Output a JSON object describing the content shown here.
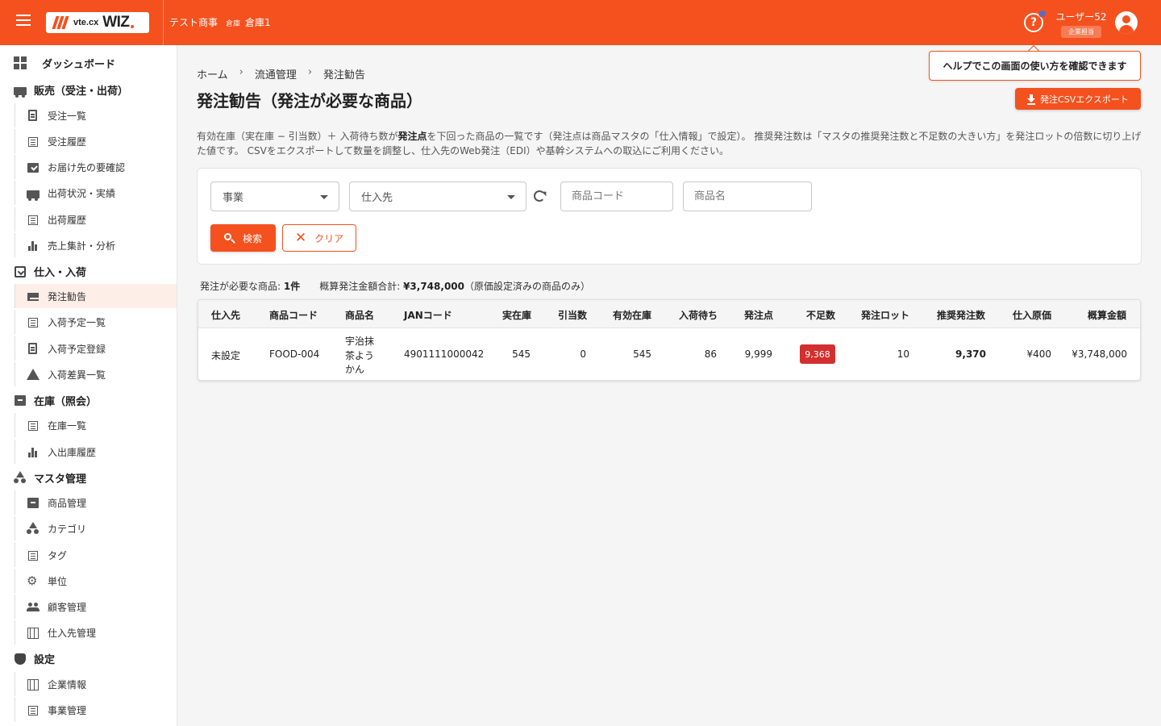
{
  "header": {
    "logo_small": "vte.cx",
    "logo_big": "WIZ",
    "company": "テスト商事",
    "warehouse_label": "倉庫",
    "warehouse": "倉庫1",
    "help_glyph": "?",
    "user_name": "ユーザー52",
    "user_role": "企業担当"
  },
  "tooltip": {
    "text": "ヘルプでこの画面の使い方を確認できます"
  },
  "sidebar": {
    "dashboard": "ダッシュボード",
    "sales": {
      "label": "販売（受注・出荷）",
      "items": [
        "受注一覧",
        "受注履歴",
        "お届け先の要確認",
        "出荷状況・実績",
        "出荷履歴",
        "売上集計・分析"
      ]
    },
    "purchase": {
      "label": "仕入・入荷",
      "items": [
        "発注勧告",
        "入荷予定一覧",
        "入荷予定登録",
        "入荷差異一覧"
      ]
    },
    "inventory": {
      "label": "在庫（照会）",
      "items": [
        "在庫一覧",
        "入出庫履歴"
      ]
    },
    "master": {
      "label": "マスタ管理",
      "items": [
        "商品管理",
        "カテゴリ",
        "タグ",
        "単位",
        "顧客管理",
        "仕入先管理"
      ]
    },
    "settings": {
      "label": "設定",
      "items": [
        "企業情報",
        "事業管理"
      ]
    },
    "gear_glyph": "⚙"
  },
  "breadcrumb": {
    "items": [
      "ホーム",
      "流通管理",
      "発注勧告"
    ],
    "sep": "›"
  },
  "page": {
    "title": "発注勧告（発注が必要な商品）",
    "export_label": "発注CSVエクスポート",
    "desc_a": "有効在庫（実在庫 − 引当数）＋ 入荷待ち数が",
    "desc_bold": "発注点",
    "desc_b": "を下回った商品の一覧です（発注点は商品マスタの「仕入情報」で設定）。 推奨発注数は「マスタの推奨発注数と不足数の大きい方」を発注ロットの倍数に切り上げた値です。 CSVをエクスポートして数量を調整し、仕入先のWeb発注（EDI）や基幹システムへの取込にご利用ください。"
  },
  "filters": {
    "business_label": "事業",
    "supplier_label": "仕入先",
    "product_code_placeholder": "商品コード",
    "product_name_placeholder": "商品名",
    "search_label": "検索",
    "clear_label": "クリア",
    "clear_glyph": "✕"
  },
  "summary": {
    "count_label": "発注が必要な商品: ",
    "count_value": "1件",
    "total_label": "概算発注金額合計: ",
    "total_value": "¥3,748,000",
    "total_note": "（原価設定済みの商品のみ）"
  },
  "table": {
    "headers": [
      "仕入先",
      "商品コード",
      "商品名",
      "JANコード",
      "実在庫",
      "引当数",
      "有効在庫",
      "入荷待ち",
      "発注点",
      "不足数",
      "発注ロット",
      "推奨発注数",
      "仕入原価",
      "概算金額"
    ],
    "rows": [
      {
        "supplier": "未設定",
        "code": "FOOD-004",
        "name_line1": "宇治抹",
        "name_line2": "茶よう",
        "name_line3": "かん",
        "jan": "4901111000042",
        "stock": "545",
        "allocated": "0",
        "available": "545",
        "incoming": "86",
        "reorder_point": "9,999",
        "shortage": "9,368",
        "lot": "10",
        "recommended": "9,370",
        "unit_cost": "¥400",
        "amount": "¥3,748,000"
      }
    ]
  },
  "colors": {
    "primary": "#f4511e",
    "danger": "#d32f2f",
    "active_bg": "#fdeee8"
  }
}
